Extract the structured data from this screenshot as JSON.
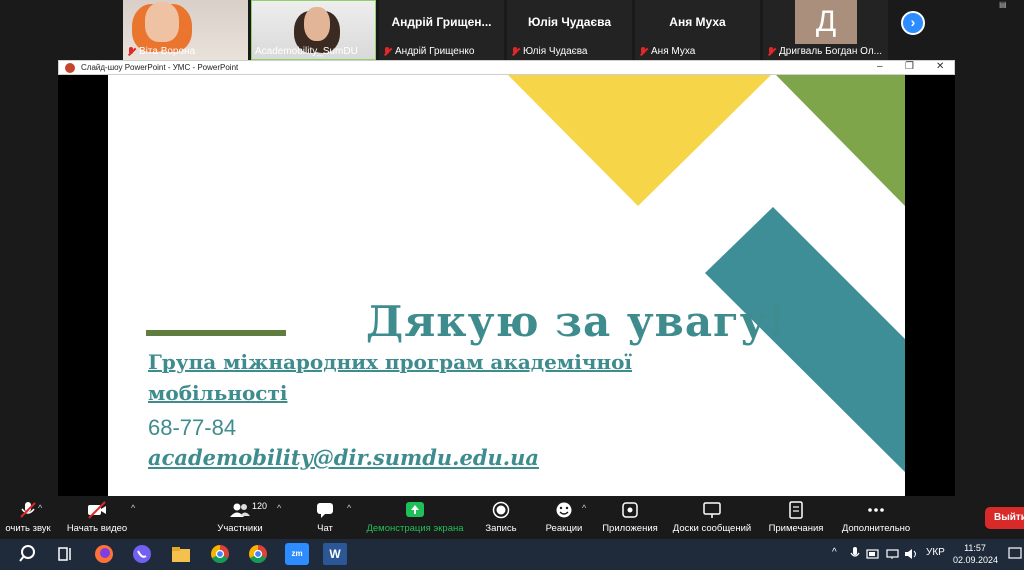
{
  "participants": [
    {
      "caption": "Віта Ворона",
      "name_center": "",
      "has_photo": true
    },
    {
      "caption": "Academobility_SumDU",
      "name_center": "",
      "has_photo": true
    },
    {
      "caption": "Андрій Грищенко",
      "name_center": "Андрій  Грищен..."
    },
    {
      "caption": "Юлія Чудаєва",
      "name_center": "Юлія Чудаєва"
    },
    {
      "caption": "Аня Муха",
      "name_center": "Аня Муха"
    },
    {
      "caption": "Дригваль Богдан Ол...",
      "avatar_letter": "Д"
    }
  ],
  "ppt_window": {
    "title": "Слайд-шоу PowerPoint  -  УМС  -  PowerPoint"
  },
  "slide": {
    "title": "Дякую за увагу!",
    "group_line1": "Група міжнародних програм академічної",
    "group_line2": "мобільності",
    "phone": "68-77-84",
    "email": "academobility@dir.sumdu.edu.ua",
    "colors": {
      "yellow": "#f7d548",
      "green": "#7ea54a",
      "teal": "#3e8e98",
      "text": "#3e8c8e"
    }
  },
  "toolbar": {
    "mute_label": "очить звук",
    "video_label": "Начать видео",
    "participants_label": "Участники",
    "participants_count": "120",
    "chat_label": "Чат",
    "share_label": "Демонстрация экрана",
    "record_label": "Запись",
    "reactions_label": "Реакции",
    "apps_label": "Приложения",
    "whiteboards_label": "Доски сообщений",
    "notes_label": "Примечания",
    "more_label": "Дополнительно",
    "leave_label": "Выйти"
  },
  "taskbar": {
    "zoom_label": "zm",
    "word_label": "W",
    "language": "УКР",
    "time": "11:57",
    "date": "02.09.2024"
  }
}
